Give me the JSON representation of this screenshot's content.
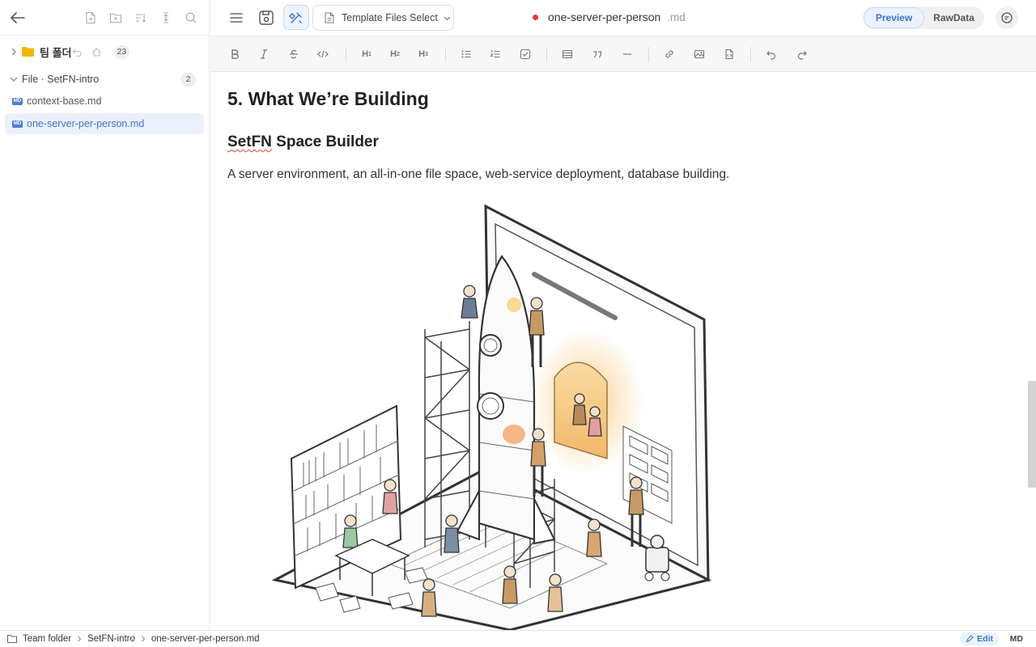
{
  "sidebar": {
    "team_folder": {
      "label": "팀 폴더",
      "count": "23"
    },
    "file_group": {
      "label": "File · SetFN-intro",
      "count": "2"
    },
    "items": [
      {
        "label": "context-base.md",
        "icon": "md-file-icon"
      },
      {
        "label": "one-server-per-person.md",
        "icon": "md-file-icon",
        "selected": true
      }
    ]
  },
  "header": {
    "template_select": "Template Files Select",
    "doc_name": "one-server-per-person",
    "doc_ext": ".md",
    "unsaved_dot_color": "#e4393c",
    "view": {
      "preview": "Preview",
      "raw": "RawData",
      "active": "Preview"
    }
  },
  "toolbar": {
    "h1": "H",
    "h2": "H",
    "h3": "H",
    "h1_sub": "1",
    "h2_sub": "2",
    "h3_sub": "3"
  },
  "content": {
    "heading": "5. What We’re Building",
    "subheading_word": "SetFN",
    "subheading_rest": " Space Builder",
    "paragraph": "A server environment, an all-in-one file space, web-service deployment, database building."
  },
  "statusbar": {
    "breadcrumb": [
      "Team folder",
      "SetFN-intro",
      "one-server-per-person.md"
    ],
    "mode": "Edit",
    "format": "MD"
  },
  "colors": {
    "accent": "#3f73c9",
    "folder": "#f2b705"
  }
}
